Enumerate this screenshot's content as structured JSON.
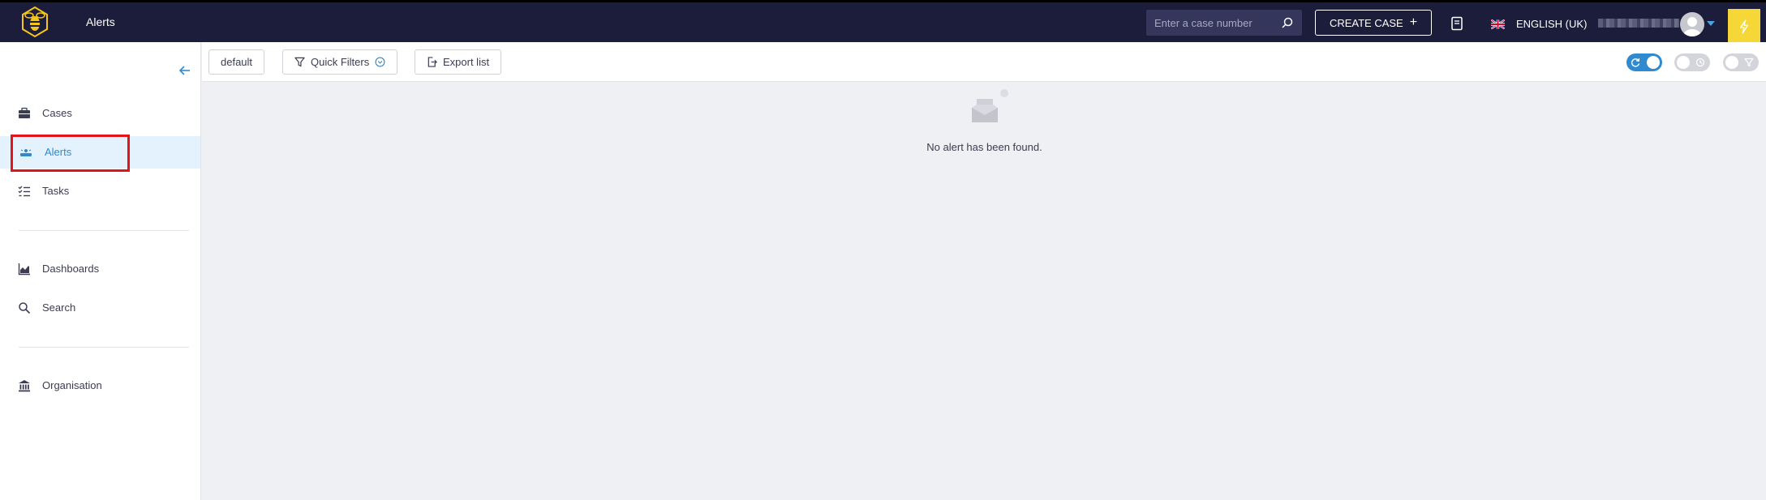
{
  "header": {
    "page_title": "Alerts",
    "search_placeholder": "Enter a case number",
    "create_case_label": "CREATE CASE",
    "language_label": "ENGLISH (UK)"
  },
  "sidebar": {
    "items": [
      {
        "label": "Cases",
        "icon": "briefcase-icon"
      },
      {
        "label": "Alerts",
        "icon": "alerts-icon",
        "active": true
      },
      {
        "label": "Tasks",
        "icon": "tasks-icon"
      },
      {
        "label": "Dashboards",
        "icon": "chart-icon"
      },
      {
        "label": "Search",
        "icon": "search-icon"
      },
      {
        "label": "Organisation",
        "icon": "bank-icon"
      }
    ]
  },
  "toolbar": {
    "filter_label": "default",
    "quick_filters_label": "Quick Filters",
    "export_label": "Export list"
  },
  "main": {
    "empty_message": "No alert has been found."
  },
  "colors": {
    "topbar_bg": "#1c1d3a",
    "accent": "#2f8ad0",
    "active_bg": "#e3f2fd",
    "highlight": "#e0141a",
    "bolt_bg": "#f5d738"
  }
}
